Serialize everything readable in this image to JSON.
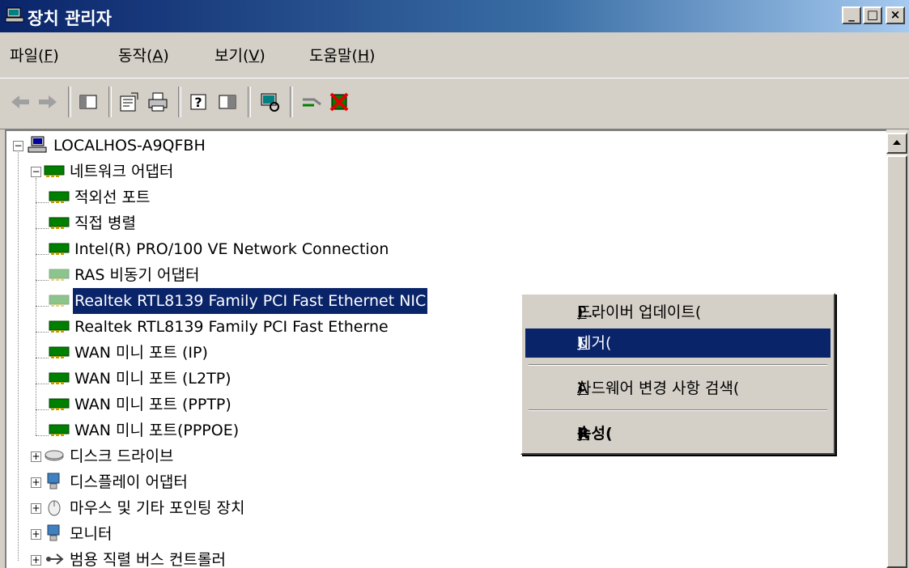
{
  "window": {
    "title": "장치 관리자",
    "controls": {
      "minimize": "_",
      "maximize": "□",
      "close": "×"
    }
  },
  "menu": [
    {
      "label": "파일(",
      "hotkey": "F",
      "suffix": ")"
    },
    {
      "label": "동작(",
      "hotkey": "A",
      "suffix": ")"
    },
    {
      "label": "보기(",
      "hotkey": "V",
      "suffix": ")"
    },
    {
      "label": "도움말(",
      "hotkey": "H",
      "suffix": ")"
    }
  ],
  "toolbar": {
    "icons": [
      "back-icon",
      "forward-icon",
      "show-hide-console-tree-icon",
      "properties-icon",
      "print-icon",
      "help-icon",
      "console-pane-icon",
      "scan-hardware-icon",
      "update-driver-icon",
      "uninstall-icon"
    ]
  },
  "tree": {
    "root": "LOCALHOS-A9QFBH",
    "network_group": "네트워크 어댑터",
    "network_items": [
      "적외선 포트",
      "직접 병렬",
      "Intel(R) PRO/100 VE Network Connection",
      "RAS 비동기 어댑터",
      "Realtek RTL8139 Family PCI Fast Ethernet NIC",
      "Realtek RTL8139 Family PCI Fast Etherne",
      "WAN 미니 포트 (IP)",
      "WAN 미니 포트 (L2TP)",
      "WAN 미니 포트 (PPTP)",
      "WAN 미니 포트(PPPOE)"
    ],
    "other_groups": [
      "디스크 드라이브",
      "디스플레이 어댑터",
      "마우스 및 기타 포인팅 장치",
      "모니터",
      "범용 직렬 버스 컨트롤러"
    ],
    "expander_collapsed": "+",
    "expander_expanded": "−"
  },
  "context_menu": {
    "items": [
      {
        "pre": "드라이버 업데이트(",
        "hotkey": "P",
        "post": ")..."
      },
      {
        "pre": "제거(",
        "hotkey": "U",
        "post": ")"
      },
      {
        "pre": "하드웨어 변경 사항 검색(",
        "hotkey": "A",
        "post": ")"
      },
      {
        "pre": "속성(",
        "hotkey": "R",
        "post": ")"
      }
    ]
  },
  "colors": {
    "selection": "#0a246a",
    "face": "#d4d0c8"
  }
}
